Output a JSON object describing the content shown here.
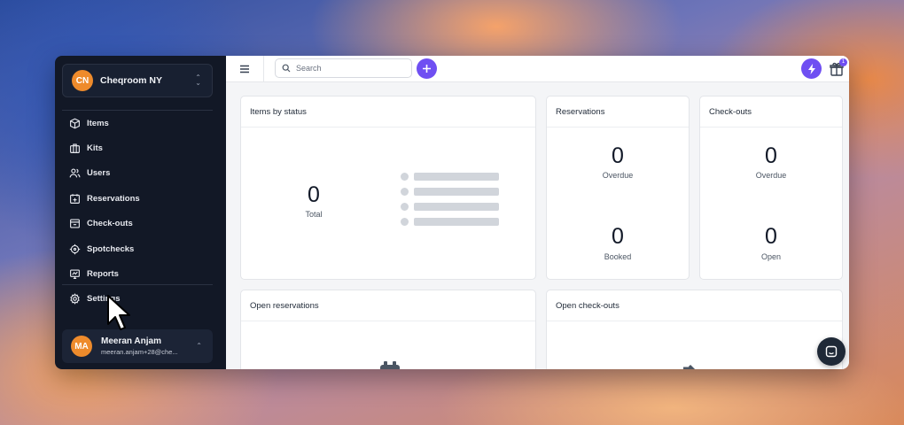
{
  "org": {
    "initials": "CN",
    "name": "Cheqroom NY"
  },
  "nav": {
    "items": [
      {
        "label": "Items",
        "icon": "box-icon"
      },
      {
        "label": "Kits",
        "icon": "briefcase-icon"
      },
      {
        "label": "Users",
        "icon": "users-icon"
      },
      {
        "label": "Reservations",
        "icon": "calendar-plus-icon"
      },
      {
        "label": "Check-outs",
        "icon": "checkout-box-icon"
      },
      {
        "label": "Spotchecks",
        "icon": "crosshair-icon"
      },
      {
        "label": "Reports",
        "icon": "chart-icon"
      }
    ],
    "settings": {
      "label": "Settings",
      "icon": "gear-icon"
    }
  },
  "user": {
    "initials": "MA",
    "name": "Meeran Anjam",
    "email": "meeran.anjam+28@che..."
  },
  "topbar": {
    "search_placeholder": "Search",
    "notification_count": "1"
  },
  "cards": {
    "items_by_status": {
      "title": "Items by status",
      "total_value": "0",
      "total_label": "Total"
    },
    "reservations": {
      "title": "Reservations",
      "overdue_value": "0",
      "overdue_label": "Overdue",
      "booked_value": "0",
      "booked_label": "Booked"
    },
    "checkouts": {
      "title": "Check-outs",
      "overdue_value": "0",
      "overdue_label": "Overdue",
      "open_value": "0",
      "open_label": "Open"
    },
    "open_reservations": {
      "title": "Open reservations"
    },
    "open_checkouts": {
      "title": "Open check-outs"
    }
  },
  "colors": {
    "accent": "#6f4ff2",
    "sidebar": "#121826",
    "avatar": "#ee8b2c"
  }
}
